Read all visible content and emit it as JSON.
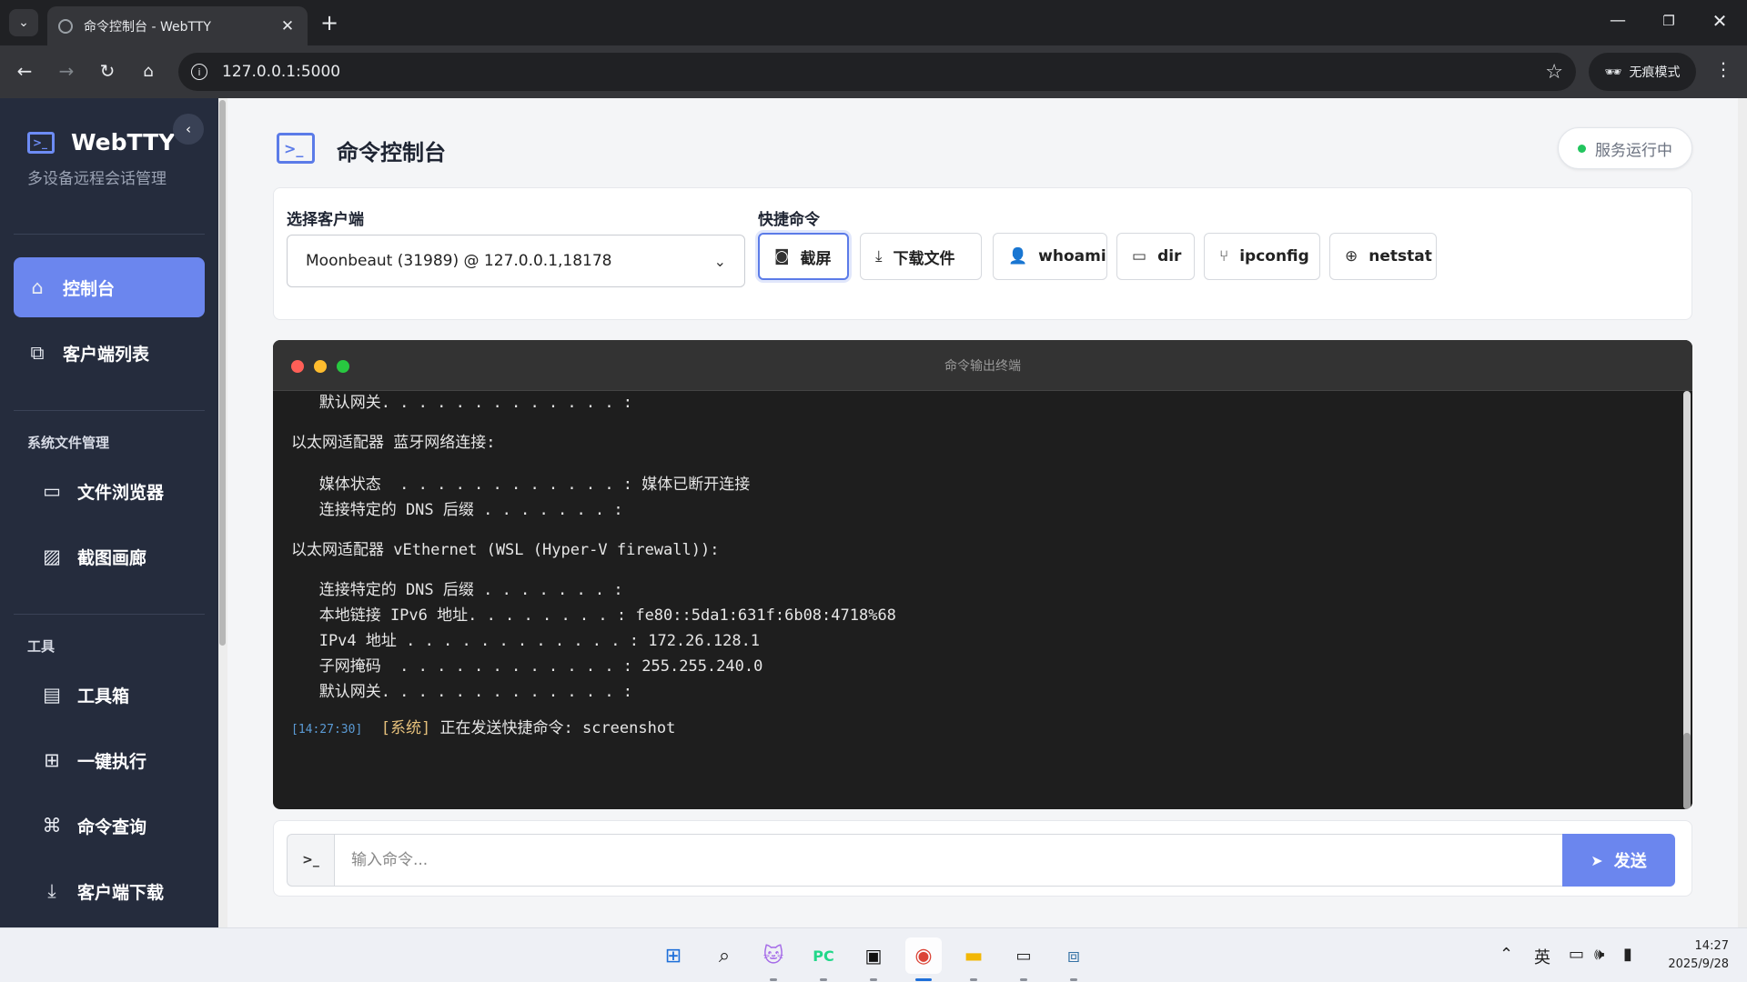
{
  "browser": {
    "tab_title": "命令控制台 - WebTTY",
    "url": "127.0.0.1:5000",
    "incognito_label": "无痕模式"
  },
  "sidebar": {
    "brand": "WebTTY",
    "subtitle": "多设备远程会话管理",
    "items": [
      {
        "label": "控制台",
        "icon": "home-icon"
      },
      {
        "label": "客户端列表",
        "icon": "clients-icon"
      }
    ],
    "section_files": "系统文件管理",
    "file_items": [
      {
        "label": "文件浏览器",
        "icon": "folder-icon"
      },
      {
        "label": "截图画廊",
        "icon": "gallery-icon"
      }
    ],
    "section_tools": "工具",
    "tool_items": [
      {
        "label": "工具箱",
        "icon": "toolbox-icon"
      },
      {
        "label": "一键执行",
        "icon": "plus-square-icon"
      },
      {
        "label": "命令查询",
        "icon": "command-icon"
      },
      {
        "label": "客户端下载",
        "icon": "download-icon"
      }
    ]
  },
  "header": {
    "title": "命令控制台",
    "status": "服务运行中"
  },
  "controls": {
    "client_label": "选择客户端",
    "client_selected": "Moonbeaut (31989) @ 127.0.0.1,18178",
    "quick_label": "快捷命令",
    "quick_commands": [
      "截屏",
      "下载文件",
      "whoami",
      "dir",
      "ipconfig",
      "netstat"
    ]
  },
  "terminal": {
    "title": "命令输出终端",
    "lines": [
      "   默认网关. . . . . . . . . . . . . :",
      "以太网适配器 蓝牙网络连接:",
      "   媒体状态  . . . . . . . . . . . . : 媒体已断开连接",
      "   连接特定的 DNS 后缀 . . . . . . . :",
      "以太网适配器 vEthernet (WSL (Hyper-V firewall)):",
      "   连接特定的 DNS 后缀 . . . . . . . :",
      "   本地链接 IPv6 地址. . . . . . . . : fe80::5da1:631f:6b08:4718%68",
      "   IPv4 地址 . . . . . . . . . . . . : 172.26.128.1",
      "   子网掩码  . . . . . . . . . . . . : 255.255.240.0",
      "   默认网关. . . . . . . . . . . . . :"
    ],
    "last_timestamp": "[14:27:30]",
    "last_tag": "[系统]",
    "last_message": "正在发送快捷命令: screenshot"
  },
  "input": {
    "placeholder": "输入命令...",
    "send_label": "发送"
  },
  "taskbar": {
    "ime": "英",
    "time": "14:27",
    "date": "2025/9/28"
  },
  "colors": {
    "accent": "#6b86ee",
    "sidebar_bg": "#252c3d",
    "terminal_bg": "#1e1e1e",
    "status_green": "#22c55e"
  }
}
